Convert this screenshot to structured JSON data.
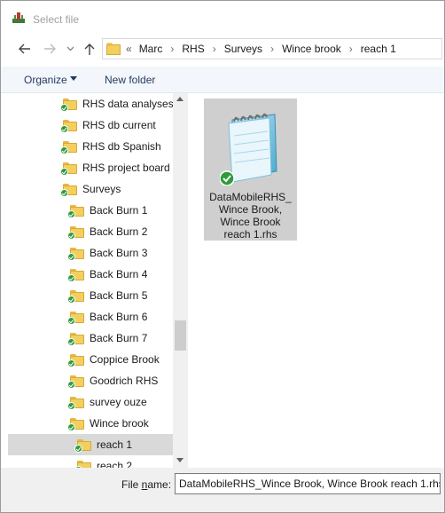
{
  "window": {
    "title": "Select file"
  },
  "address": {
    "overflow": "«",
    "breadcrumbs": [
      "Marc",
      "RHS",
      "Surveys",
      "Wince brook",
      "reach 1"
    ]
  },
  "toolbar": {
    "organize_label": "Organize",
    "new_folder_label": "New folder"
  },
  "navigation": {
    "items": [
      {
        "label": "RHS data analyses",
        "level": 1
      },
      {
        "label": "RHS db current",
        "level": 1
      },
      {
        "label": "RHS db Spanish",
        "level": 1
      },
      {
        "label": "RHS project board",
        "level": 1
      },
      {
        "label": "Surveys",
        "level": 1
      },
      {
        "label": "Back Burn 1",
        "level": 2
      },
      {
        "label": "Back Burn 2",
        "level": 2
      },
      {
        "label": "Back Burn 3",
        "level": 2
      },
      {
        "label": "Back Burn 4",
        "level": 2
      },
      {
        "label": "Back Burn 5",
        "level": 2
      },
      {
        "label": "Back Burn 6",
        "level": 2
      },
      {
        "label": "Back Burn 7",
        "level": 2
      },
      {
        "label": "Coppice Brook",
        "level": 2
      },
      {
        "label": "Goodrich RHS",
        "level": 2
      },
      {
        "label": "survey ouze",
        "level": 2
      },
      {
        "label": "Wince brook",
        "level": 2
      },
      {
        "label": "reach 1",
        "level": 3,
        "selected": true
      },
      {
        "label": "reach 2",
        "level": 3
      }
    ]
  },
  "files": [
    {
      "name": "DataMobileRHS_ Wince Brook, Wince Brook reach 1.rhs",
      "selected": true
    }
  ],
  "footer": {
    "file_name_label_prefix": "File ",
    "file_name_label_hotkey": "n",
    "file_name_label_suffix": "ame:",
    "file_name_value": "DataMobileRHS_Wince Brook, Wince Brook reach 1.rhs"
  },
  "colors": {
    "selection": "#d9d9d9",
    "command_bar": "#f3f6fa",
    "folder": "#f3cf5e",
    "sync_check": "#2e9b3a"
  }
}
